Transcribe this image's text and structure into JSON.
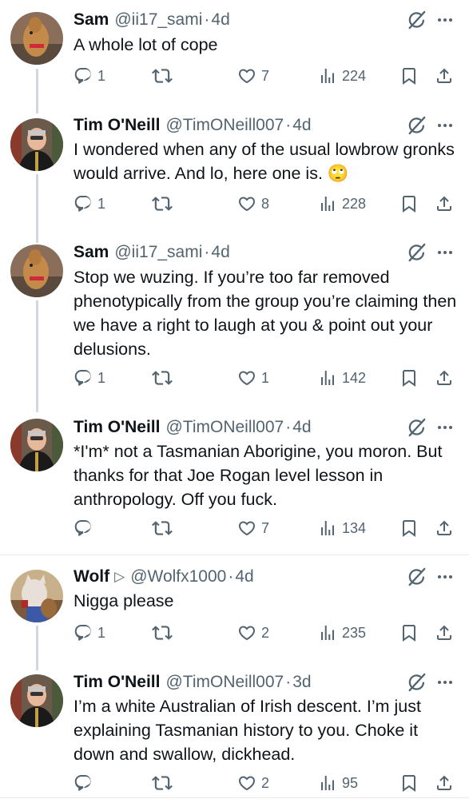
{
  "tweets": [
    {
      "name": "Sam",
      "handle": "@ii17_sami",
      "time": "4d",
      "text": "A whole lot of cope",
      "replies": "1",
      "retweets": "",
      "likes": "7",
      "views": "224",
      "avatar": "dog-avatar"
    },
    {
      "name": "Tim O'Neill",
      "handle": "@TimONeill007",
      "time": "4d",
      "text": "I wondered when any of the usual lowbrow gronks would arrive. And lo, here one is. 🙄",
      "replies": "1",
      "retweets": "",
      "likes": "8",
      "views": "228",
      "avatar": "man-avatar"
    },
    {
      "name": "Sam",
      "handle": "@ii17_sami",
      "time": "4d",
      "text": "Stop we wuzing. If you’re too far removed phenotypically from the group you’re claiming then we have a right to laugh at you & point out your delusions.",
      "replies": "1",
      "retweets": "",
      "likes": "1",
      "views": "142",
      "avatar": "dog-avatar"
    },
    {
      "name": "Tim O'Neill",
      "handle": "@TimONeill007",
      "time": "4d",
      "text": "*I'm* not a Tasmanian Aborigine, you moron. But thanks for that Joe Rogan level lesson in anthropology. Off you fuck.",
      "replies": "",
      "retweets": "",
      "likes": "7",
      "views": "134",
      "avatar": "man-avatar"
    },
    {
      "name": "Wolf",
      "handle": "@Wolfx1000",
      "time": "4d",
      "text": "Nigga please",
      "replies": "1",
      "retweets": "",
      "likes": "2",
      "views": "235",
      "avatar": "wolf-avatar"
    },
    {
      "name": "Tim O'Neill",
      "handle": "@TimONeill007",
      "time": "3d",
      "text": "I’m a white Australian of Irish descent. I’m just explaining Tasmanian history to you. Choke it down and swallow, dickhead.",
      "replies": "",
      "retweets": "",
      "likes": "2",
      "views": "95",
      "avatar": "man-avatar"
    }
  ],
  "colors": {
    "text": "#0f1419",
    "muted": "#536471",
    "thread_line": "#cfd9de",
    "divider": "#e6ecf0"
  }
}
